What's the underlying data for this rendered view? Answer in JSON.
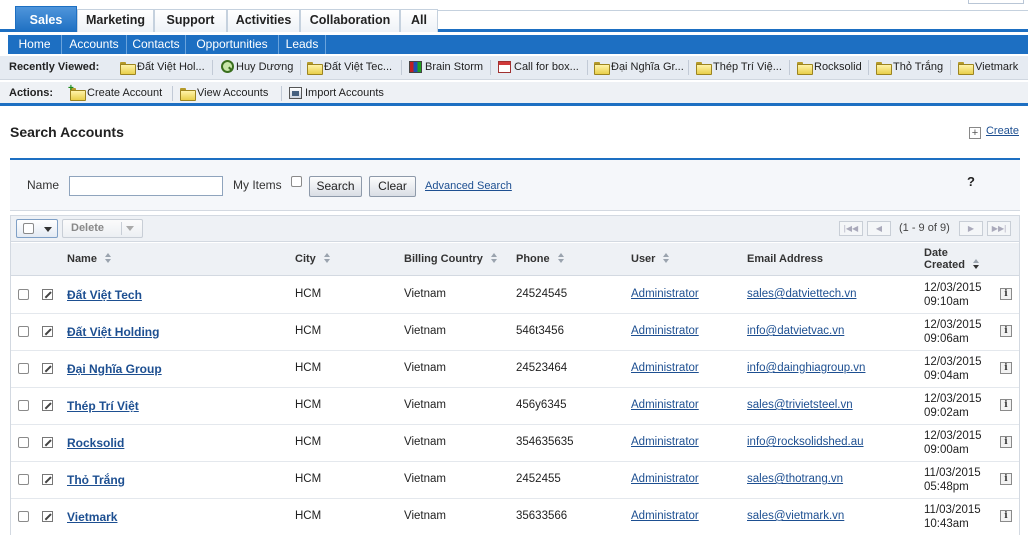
{
  "module_tabs": [
    {
      "label": "Sales",
      "active": true
    },
    {
      "label": "Marketing"
    },
    {
      "label": "Support"
    },
    {
      "label": "Activities"
    },
    {
      "label": "Collaboration"
    },
    {
      "label": "All"
    }
  ],
  "sub_tabs": [
    "Home",
    "Accounts",
    "Contacts",
    "Opportunities",
    "Leads"
  ],
  "recently_viewed": {
    "label": "Recently Viewed:",
    "items": [
      {
        "label": "Đất Việt Hol...",
        "icon": "folder-icon"
      },
      {
        "label": "Huy Dương",
        "icon": "user-search-icon"
      },
      {
        "label": "Đất Việt Tec...",
        "icon": "folder-icon"
      },
      {
        "label": "Brain Storm",
        "icon": "meeting-icon"
      },
      {
        "label": "Call for box...",
        "icon": "calendar-icon"
      },
      {
        "label": "Đại Nghĩa Gr...",
        "icon": "folder-icon"
      },
      {
        "label": "Thép Trí Việ...",
        "icon": "folder-icon"
      },
      {
        "label": "Rocksolid",
        "icon": "folder-icon"
      },
      {
        "label": "Thỏ Trắng",
        "icon": "folder-icon"
      },
      {
        "label": "Vietmark",
        "icon": "folder-icon"
      }
    ]
  },
  "actions": {
    "label": "Actions:",
    "items": [
      {
        "label": "Create Account",
        "icon": "create-folder-icon"
      },
      {
        "label": "View Accounts",
        "icon": "folder-icon"
      },
      {
        "label": "Import Accounts",
        "icon": "import-icon"
      }
    ]
  },
  "page": {
    "title": "Search Accounts",
    "create_label": "Create"
  },
  "search": {
    "name_label": "Name",
    "name_value": "",
    "my_items_label": "My Items",
    "search_button": "Search",
    "clear_button": "Clear",
    "advanced_link": "Advanced Search",
    "help": "?"
  },
  "list": {
    "delete_label": "Delete",
    "pager_text": "(1 - 9 of 9)",
    "columns": {
      "name": "Name",
      "city": "City",
      "country": "Billing Country",
      "phone": "Phone",
      "user": "User",
      "email": "Email Address",
      "date_line1": "Date",
      "date_line2": "Created"
    },
    "rows": [
      {
        "name": "Đất Việt Tech",
        "city": "HCM",
        "country": "Vietnam",
        "phone": "24524545",
        "user": "Administrator",
        "email": "sales@datviettech.vn",
        "date": "12/03/2015",
        "time": "09:10am"
      },
      {
        "name": "Đất Việt Holding",
        "city": "HCM",
        "country": "Vietnam",
        "phone": "546t3456",
        "user": "Administrator",
        "email": "info@datvietvac.vn",
        "date": "12/03/2015",
        "time": "09:06am"
      },
      {
        "name": "Đại Nghĩa Group",
        "city": "HCM",
        "country": "Vietnam",
        "phone": "24523464",
        "user": "Administrator",
        "email": "info@dainghiagroup.vn",
        "date": "12/03/2015",
        "time": "09:04am"
      },
      {
        "name": "Thép Trí Việt",
        "city": "HCM",
        "country": "Vietnam",
        "phone": "456y6345",
        "user": "Administrator",
        "email": "sales@trivietsteel.vn",
        "date": "12/03/2015",
        "time": "09:02am"
      },
      {
        "name": "Rocksolid",
        "city": "HCM",
        "country": "Vietnam",
        "phone": "354635635",
        "user": "Administrator",
        "email": "info@rocksolidshed.au",
        "date": "12/03/2015",
        "time": "09:00am"
      },
      {
        "name": "Thỏ Trắng",
        "city": "HCM",
        "country": "Vietnam",
        "phone": "2452455",
        "user": "Administrator",
        "email": "sales@thotrang.vn",
        "date": "11/03/2015",
        "time": "05:48pm"
      },
      {
        "name": "Vietmark",
        "city": "HCM",
        "country": "Vietnam",
        "phone": "35633566",
        "user": "Administrator",
        "email": "sales@vietmark.vn",
        "date": "11/03/2015",
        "time": "10:43am"
      }
    ]
  },
  "colors": {
    "accent": "#1d6fc2",
    "link": "#1d4f91",
    "toolbar_bg": "#e6ebf2"
  }
}
